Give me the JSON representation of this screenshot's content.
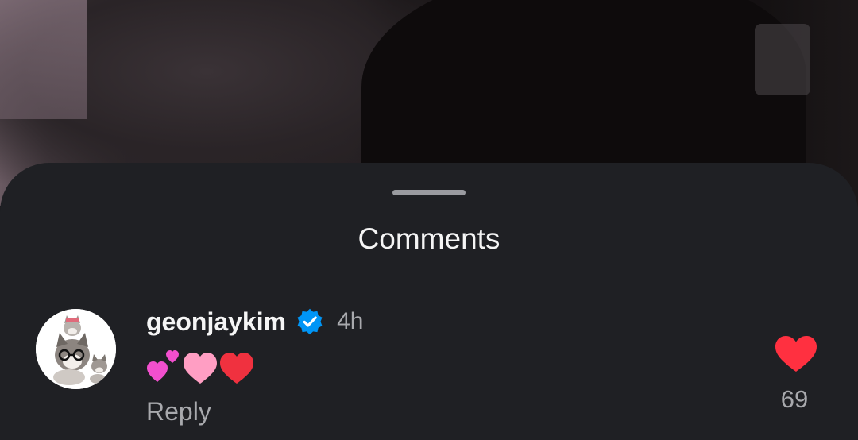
{
  "sheet": {
    "title": "Comments"
  },
  "comment": {
    "username": "geonjaykim",
    "verified": true,
    "time": "4h",
    "text": "💕🩷❤️",
    "reply_label": "Reply",
    "like_count": "69",
    "like_color": "#ff3040",
    "verified_color": "#0095f6"
  },
  "colors": {
    "sheet_background": "#1f2024",
    "primary_text": "#f5f5f5",
    "secondary_text": "#a8a9ad"
  },
  "icons": {
    "avatar": "cats-avatar",
    "verified": "verified-badge-icon",
    "like": "heart-icon"
  }
}
